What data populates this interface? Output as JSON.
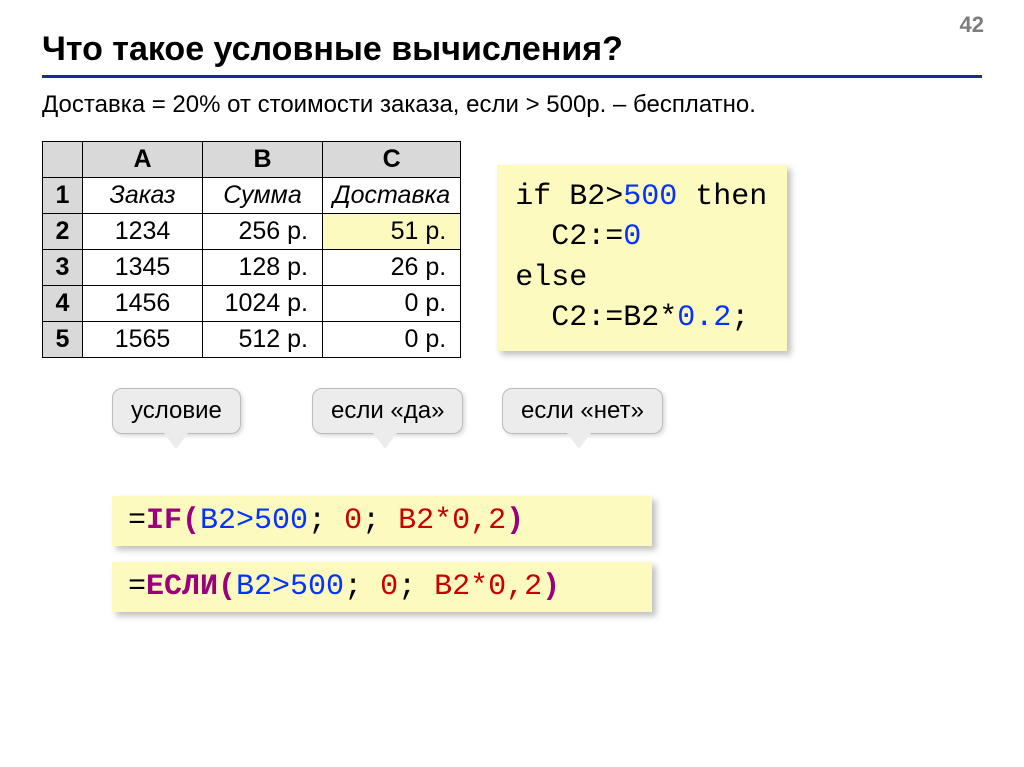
{
  "page_number": "42",
  "title": "Что такое условные вычисления?",
  "subtitle": "Доставка = 20% от стоимости заказа, если > 500р. – бесплатно.",
  "table": {
    "cols": [
      "A",
      "B",
      "C"
    ],
    "rows": [
      {
        "n": "1",
        "a": "Заказ",
        "b": "Сумма",
        "c": "Доставка",
        "header_row": true
      },
      {
        "n": "2",
        "a": "1234",
        "b": "256 р.",
        "c": "51 р.",
        "hl": true
      },
      {
        "n": "3",
        "a": "1345",
        "b": "128 р.",
        "c": "26 р."
      },
      {
        "n": "4",
        "a": "1456",
        "b": "1024 р.",
        "c": "0 р."
      },
      {
        "n": "5",
        "a": "1565",
        "b": "512 р.",
        "c": "0 р."
      }
    ]
  },
  "code": {
    "line1_kw1": "if",
    "line1_expr": " B2>",
    "line1_num": "500",
    "line1_kw2": " then",
    "line2_pre": "  C2:=",
    "line2_num": "0",
    "line3_kw": "else",
    "line4_pre": "  C2:=B2*",
    "line4_num": "0.2",
    "line4_end": ";"
  },
  "callouts": {
    "c1": "условие",
    "c2": "если «да»",
    "c3": "если «нет»"
  },
  "formula1": {
    "eq": "=",
    "fn": "IF",
    "open": "(",
    "arg1": "B2>500",
    "sep1": "; ",
    "arg2": "0",
    "sep2": "; ",
    "arg3": "B2*0,2",
    "close": ")"
  },
  "formula2": {
    "eq": "=",
    "fn": "ЕСЛИ",
    "open": "(",
    "arg1": "B2>500",
    "sep1": "; ",
    "arg2": "0",
    "sep2": "; ",
    "arg3": "B2*0,2",
    "close": ")"
  }
}
